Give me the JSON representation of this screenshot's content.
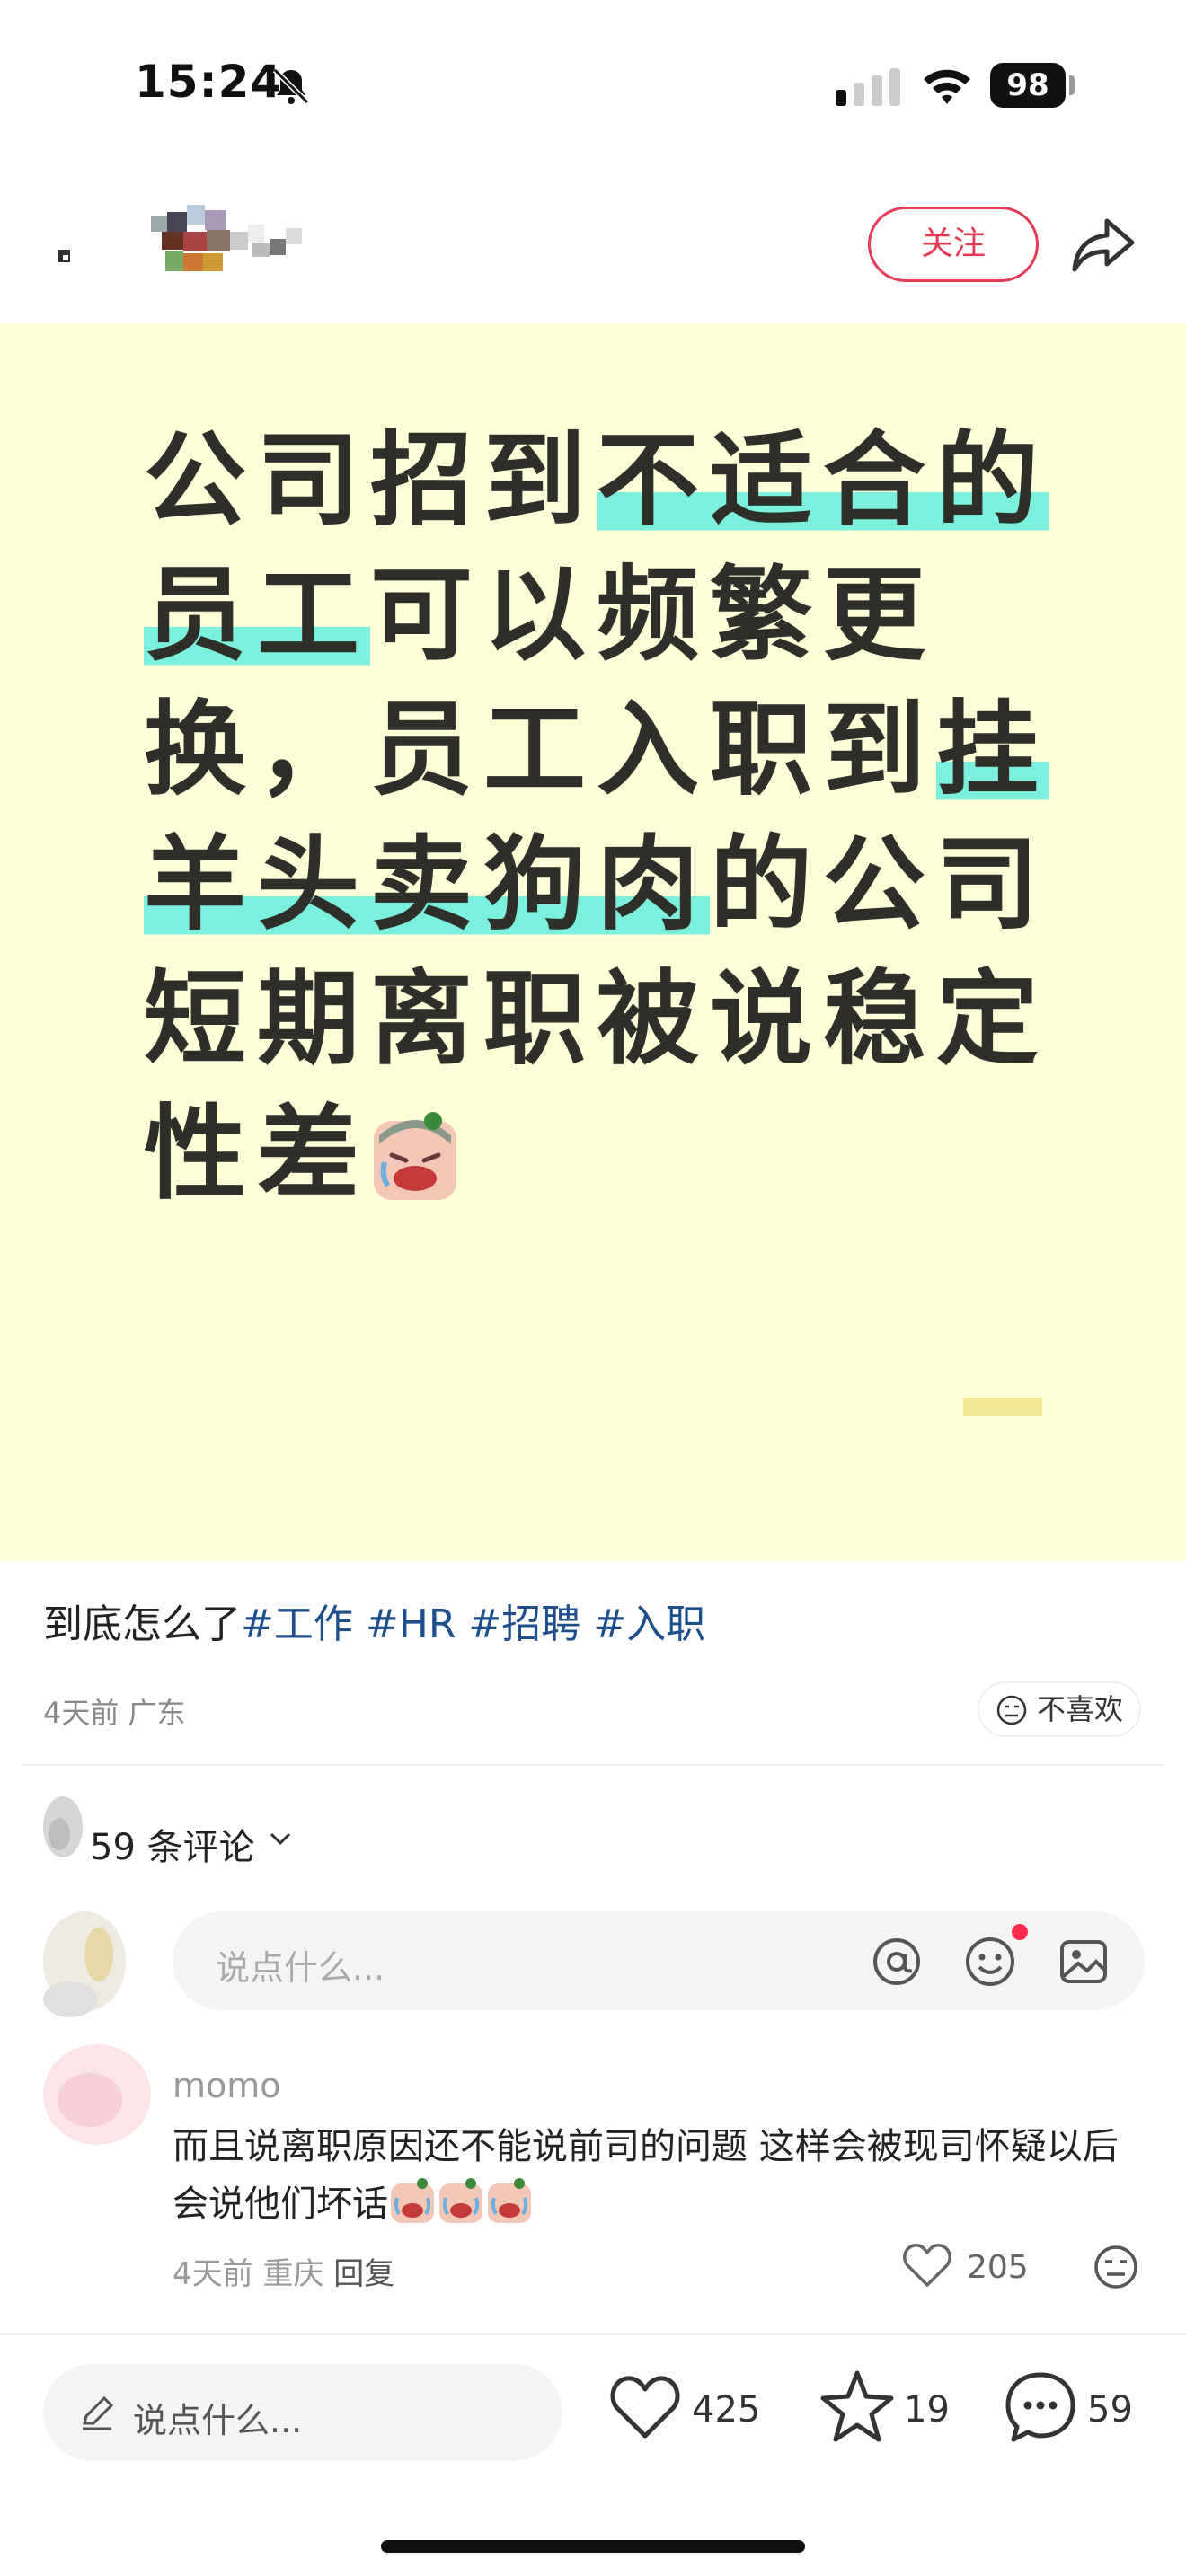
{
  "status_bar": {
    "time": "15:24",
    "battery": "98",
    "icons": [
      "bell-slash-icon",
      "signal-icon",
      "wifi-icon",
      "battery-icon"
    ]
  },
  "nav": {
    "follow_label": "关注",
    "icons": [
      "back-icon",
      "share-icon"
    ]
  },
  "post": {
    "headline_segments": [
      {
        "text": "公司招到",
        "highlight": false
      },
      {
        "text": "不适合的",
        "highlight": true
      },
      {
        "text": "员工",
        "highlight": true
      },
      {
        "text": "可以频繁更换，",
        "highlight": false
      },
      {
        "text": "员工入职到",
        "highlight": false
      },
      {
        "text": "挂羊头",
        "highlight": true
      },
      {
        "text": "卖狗肉",
        "highlight": true
      },
      {
        "text": "的公司短期离职被说稳定性差",
        "highlight": false
      }
    ],
    "highlight_color": "#7af0dd",
    "background_color": "#ffffd8",
    "caption_text": "到底怎么了",
    "tags": [
      "#工作",
      "#HR",
      "#招聘",
      "#入职"
    ],
    "meta": "4天前 广东",
    "dislike_label": "不喜欢"
  },
  "comments": {
    "count_label": "59 条评论",
    "input_placeholder": "说点什么...",
    "items": [
      {
        "username": "momo",
        "text": "而且说离职原因还不能说前司的问题 这样会被现司怀疑以后会说他们坏话",
        "emoji_count": 3,
        "meta": "4天前 重庆",
        "reply_label": "回复",
        "likes": "205"
      }
    ]
  },
  "bottom_bar": {
    "input_placeholder": "说点什么...",
    "likes": "425",
    "stars": "19",
    "comments": "59"
  },
  "colors": {
    "accent": "#e33b55",
    "tag": "#1f4e8c",
    "notification_dot": "#ff2a4d"
  }
}
